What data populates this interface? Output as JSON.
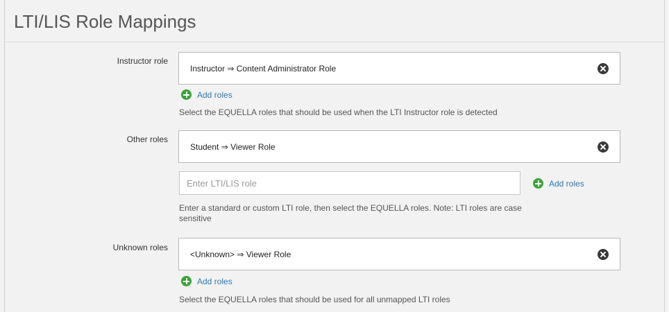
{
  "page": {
    "title": "LTI/LIS Role Mappings"
  },
  "instructor": {
    "label": "Instructor role",
    "mapping": "Instructor ⇒ Content Administrator Role",
    "add_label": "Add roles",
    "help": "Select the EQUELLA roles that should be used when the LTI Instructor role is detected"
  },
  "other": {
    "label": "Other roles",
    "mapping": "Student ⇒ Viewer Role",
    "input_placeholder": "Enter LTI/LIS role",
    "add_label": "Add roles",
    "help_line1": "Enter a standard or custom LTI role, then select the EQUELLA roles. Note: LTI roles are case",
    "help_line2": "sensitive"
  },
  "unknown": {
    "label": "Unknown roles",
    "mapping": "<Unknown> ⇒ Viewer Role",
    "add_label": "Add roles",
    "help": "Select the EQUELLA roles that should be used for all unmapped LTI roles"
  },
  "icons": {
    "remove": "remove-circle-icon",
    "add": "plus-circle-icon"
  },
  "colors": {
    "link": "#2a7ab8",
    "add_icon": "#3aa43a",
    "remove_icon": "#3a3a3a"
  }
}
